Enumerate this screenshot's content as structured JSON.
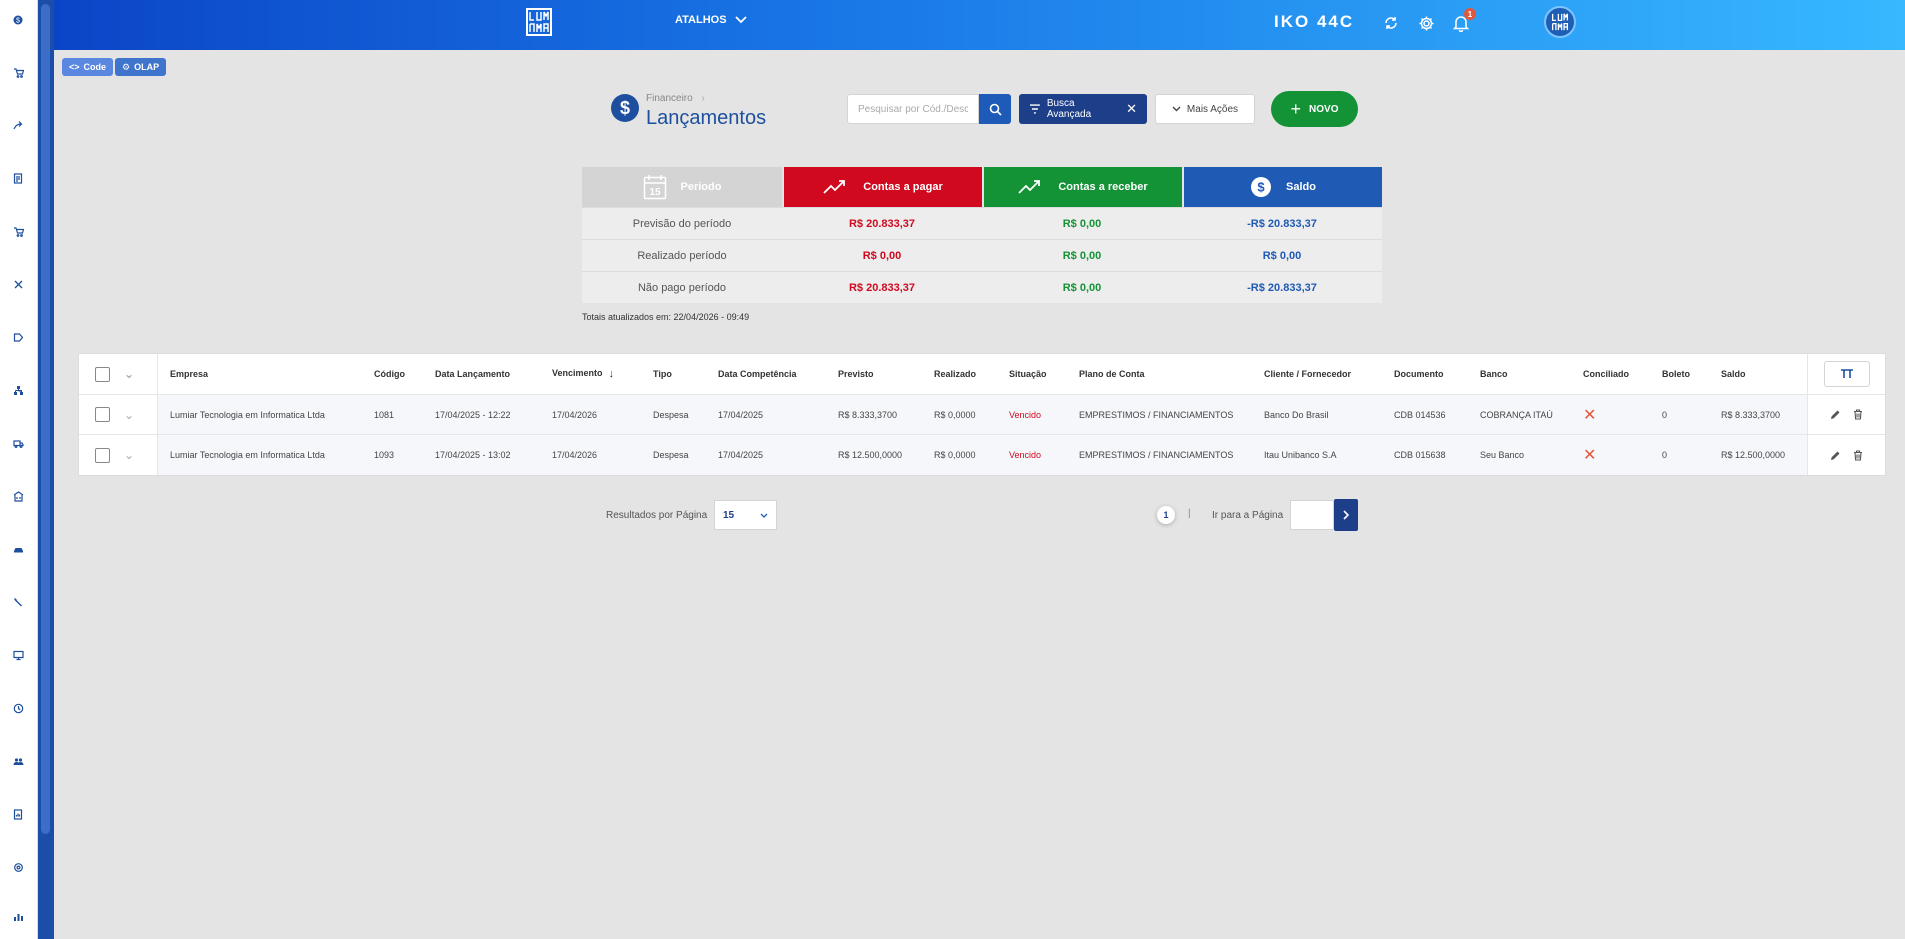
{
  "app": {
    "company": "IKO 44C",
    "shortcuts_label": "ATALHOS",
    "notification_count": "1",
    "logo_text": "LUMIAR"
  },
  "pills": {
    "code": "Code",
    "olap": "OLAP"
  },
  "page": {
    "breadcrumb": "Financeiro",
    "title": "Lançamentos"
  },
  "toolbar": {
    "search_placeholder": "Pesquisar por Cód./Desc.",
    "busca_label": "Busca Avançada",
    "mais_label": "Mais Ações",
    "novo_label": "NOVO"
  },
  "summary": {
    "headers": {
      "periodo": "Período",
      "calendar_day": "15",
      "pagar": "Contas a pagar",
      "receber": "Contas a receber",
      "saldo": "Saldo"
    },
    "rows": [
      {
        "label": "Previsão do período",
        "pagar": "R$ 20.833,37",
        "receber": "R$ 0,00",
        "saldo": "-R$ 20.833,37"
      },
      {
        "label": "Realizado período",
        "pagar": "R$ 0,00",
        "receber": "R$ 0,00",
        "saldo": "R$ 0,00"
      },
      {
        "label": "Não pago período",
        "pagar": "R$ 20.833,37",
        "receber": "R$ 0,00",
        "saldo": "-R$ 20.833,37"
      }
    ],
    "totais": "Totais atualizados em: 22/04/2026 - 09:49"
  },
  "table": {
    "columns": [
      "Empresa",
      "Código",
      "Data Lançamento",
      "Vencimento",
      "Tipo",
      "Data Competência",
      "Previsto",
      "Realizado",
      "Situação",
      "Plano de Conta",
      "Cliente / Fornecedor",
      "Documento",
      "Banco",
      "Conciliado",
      "Boleto",
      "Saldo"
    ],
    "rows": [
      [
        "Lumiar Tecnologia em Informatica Ltda",
        "1081",
        "17/04/2025 - 12:22",
        "17/04/2026",
        "Despesa",
        "17/04/2025",
        "R$ 8.333,3700",
        "R$ 0,0000",
        "Vencido",
        "EMPRESTIMOS / FINANCIAMENTOS",
        "Banco Do Brasil",
        "CDB 014536",
        "COBRANÇA ITAÚ",
        "✕",
        "0",
        "R$ 8.333,3700"
      ],
      [
        "Lumiar Tecnologia em Informatica Ltda",
        "1093",
        "17/04/2025 - 13:02",
        "17/04/2026",
        "Despesa",
        "17/04/2025",
        "R$ 12.500,0000",
        "R$ 0,0000",
        "Vencido",
        "EMPRESTIMOS / FINANCIAMENTOS",
        "Itau Unibanco S.A",
        "CDB 015638",
        "Seu Banco",
        "✕",
        "0",
        "R$ 12.500,0000"
      ]
    ],
    "sort_indicator": "↓"
  },
  "pagination": {
    "rpp_label": "Resultados por Página",
    "rpp_value": "15",
    "current_page": "1",
    "separator": "|",
    "goto_label": "Ir para a Página"
  },
  "colors": {
    "header_start": "#0b45c7",
    "header_end": "#37b8ff",
    "pagar": "#d0091f",
    "receber": "#139236",
    "saldo": "#1f5ab5",
    "primary": "#1d3f8a"
  },
  "icons": {
    "sidebar": [
      "dollar-icon",
      "cart-icon",
      "share-icon",
      "document-icon",
      "cart-icon",
      "tools-icon",
      "tag-icon",
      "org-chart-icon",
      "truck-icon",
      "building-icon",
      "car-icon",
      "wrench-icon",
      "monitor-icon",
      "clock-icon",
      "users-icon",
      "report-icon",
      "settings-icon",
      "chart-icon"
    ]
  }
}
